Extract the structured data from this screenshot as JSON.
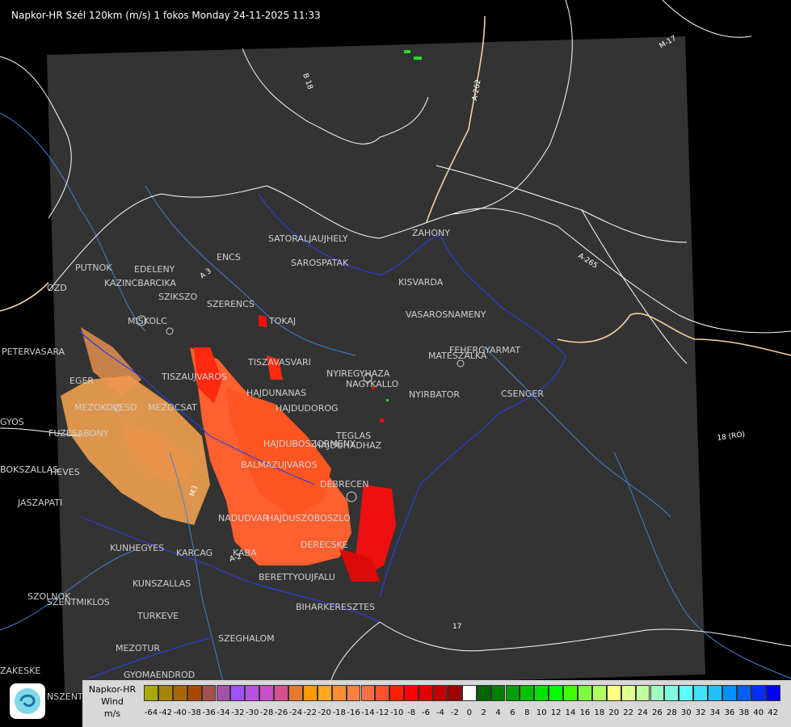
{
  "title": "Napkor-HR Szél 120km (m/s) 1 fokos Monday 24-11-2025 11:33",
  "cities": [
    {
      "name": "SATORALJAUJHELY"
    },
    {
      "name": "SAROSPATAK"
    },
    {
      "name": "ZAHONY"
    },
    {
      "name": "KISVARDA"
    },
    {
      "name": "PUTNOK"
    },
    {
      "name": "EDELENY"
    },
    {
      "name": "KAZINCBARCIKA"
    },
    {
      "name": "SZIKSZO"
    },
    {
      "name": "SZERENCS"
    },
    {
      "name": "ENCS"
    },
    {
      "name": "OZD"
    },
    {
      "name": "MISKOLC"
    },
    {
      "name": "TOKAJ"
    },
    {
      "name": "VASAROSNAMENY"
    },
    {
      "name": "FEHERGYARMAT"
    },
    {
      "name": "MATESZALKA"
    },
    {
      "name": "PETERVASARA"
    },
    {
      "name": "TISZAVASVARI"
    },
    {
      "name": "TISZAUJVAROS"
    },
    {
      "name": "NYIREGYHAZA"
    },
    {
      "name": "NAGYKALLO"
    },
    {
      "name": "EGER"
    },
    {
      "name": "HAJDUNANAS"
    },
    {
      "name": "HAJDUDOROG"
    },
    {
      "name": "NYIRBATOR"
    },
    {
      "name": "CSENGER"
    },
    {
      "name": "MEZOKOVESD"
    },
    {
      "name": "MEZOCSAT"
    },
    {
      "name": "GYOS"
    },
    {
      "name": "HAJDUBOSZORMENY"
    },
    {
      "name": "HAJDUHADHAZ"
    },
    {
      "name": "TEGLAS"
    },
    {
      "name": "FUZESABONY"
    },
    {
      "name": "HEVES"
    },
    {
      "name": "JASZAPATI"
    },
    {
      "name": "BOKSZALLAS"
    },
    {
      "name": "BALMAZUJVAROS"
    },
    {
      "name": "DEBRECEN"
    },
    {
      "name": "NADUDVAR"
    },
    {
      "name": "HAJDUSZOBOSZLO"
    },
    {
      "name": "DERECSKE"
    },
    {
      "name": "KUNHEGYES"
    },
    {
      "name": "KARCAG"
    },
    {
      "name": "KABA"
    },
    {
      "name": "BERETTYOUJFALU"
    },
    {
      "name": "KUNSZALLAS"
    },
    {
      "name": "SZOLNOK"
    },
    {
      "name": "TURKEVE"
    },
    {
      "name": "BIHARKERESZTES"
    },
    {
      "name": "SZEGHALOM"
    },
    {
      "name": "MEZOTUR"
    },
    {
      "name": "GYOMAENDROD"
    },
    {
      "name": "ZAKESKE"
    },
    {
      "name": "NSZENTMI"
    },
    {
      "name": "SZENTMIKLOS"
    }
  ],
  "roads": [
    {
      "label": "B 18"
    },
    {
      "label": "A-262"
    },
    {
      "label": "A-265"
    },
    {
      "label": "M-17"
    },
    {
      "label": "18 (RO)"
    },
    {
      "label": "A-2"
    },
    {
      "label": "17"
    },
    {
      "label": "A 3"
    },
    {
      "label": "M3"
    }
  ],
  "legend": {
    "line1": "Napkor-HR",
    "line2": "Wind",
    "line3": "m/s",
    "ticks": [
      "-64",
      "-42",
      "-40",
      "-38",
      "-36",
      "-34",
      "-32",
      "-30",
      "-28",
      "-26",
      "-24",
      "-22",
      "-20",
      "-18",
      "-16",
      "-14",
      "-12",
      "-10",
      "-8",
      "-6",
      "-4",
      "-2",
      "0",
      "2",
      "4",
      "6",
      "8",
      "10",
      "12",
      "14",
      "16",
      "18",
      "20",
      "22",
      "24",
      "26",
      "28",
      "30",
      "32",
      "34",
      "36",
      "38",
      "40",
      "42"
    ],
    "colors": [
      "#a8a800",
      "#a88400",
      "#a86400",
      "#a84800",
      "#a85050",
      "#a850a8",
      "#a050ff",
      "#b850e0",
      "#c850c8",
      "#d85090",
      "#e87830",
      "#ff9a00",
      "#ffa820",
      "#ff9030",
      "#ff8040",
      "#ff7040",
      "#ff5030",
      "#ff2000",
      "#ff0000",
      "#e00000",
      "#c00000",
      "#a00000",
      "#ffffff",
      "#006400",
      "#008000",
      "#00a000",
      "#00c000",
      "#00e000",
      "#00ff00",
      "#40ff00",
      "#80ff40",
      "#b0ff60",
      "#ffff80",
      "#e0ff90",
      "#c0ffa0",
      "#a0ffc0",
      "#80ffe0",
      "#60ffff",
      "#40e0ff",
      "#20c0ff",
      "#0090ff",
      "#0060ff",
      "#0030ff",
      "#0000ff"
    ]
  }
}
